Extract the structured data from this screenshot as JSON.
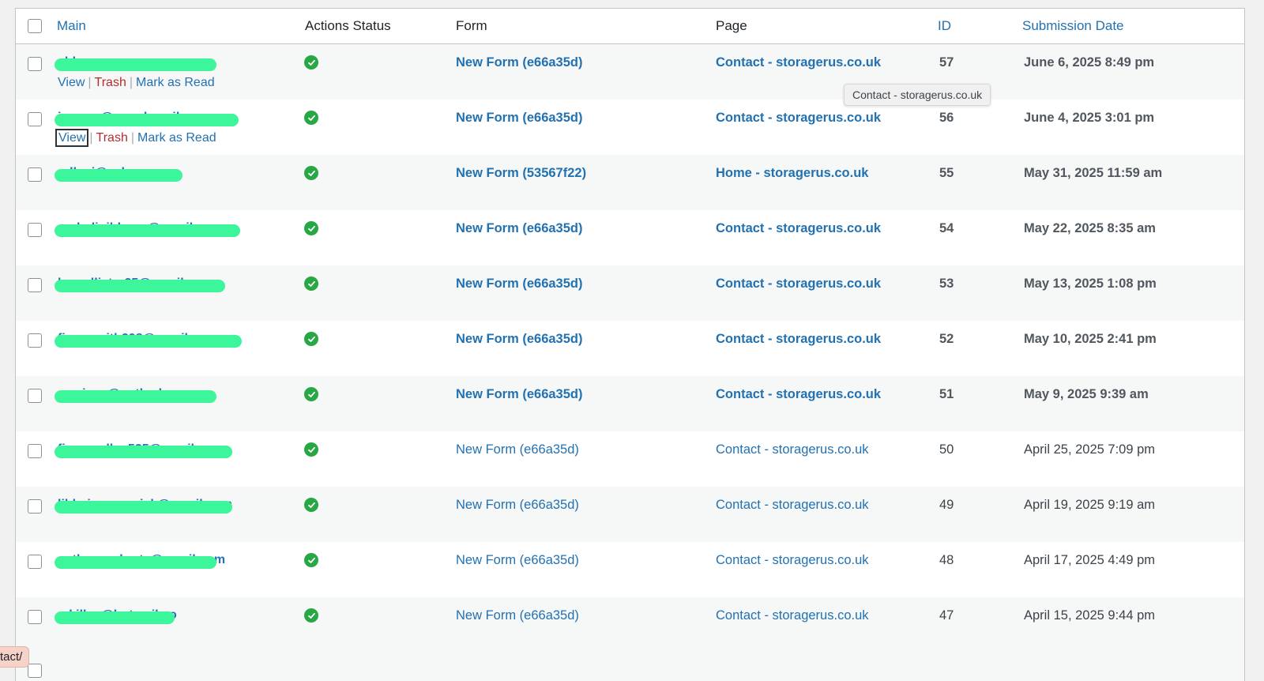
{
  "columns": {
    "main": "Main",
    "actions_status": "Actions Status",
    "form": "Form",
    "page": "Page",
    "id": "ID",
    "submission_date": "Submission Date"
  },
  "row_actions": {
    "view": "View",
    "trash": "Trash",
    "mark_read": "Mark as Read"
  },
  "tooltip": "Contact - storagerus.co.uk",
  "status_url": "tact/",
  "colors": {
    "link": "#2271b1",
    "trash": "#b32d2e",
    "success": "#28a745",
    "redaction": "#3df59a"
  },
  "rows": [
    {
      "email": "chloe",
      "form": "New Form (e66a35d)",
      "page": "Contact - storagerus.co.uk",
      "id": "57",
      "date": "June 6, 2025 8:49 pm",
      "unread": true
    },
    {
      "email": "jasonw@googlemail.com",
      "form": "New Form (e66a35d)",
      "page": "Contact - storagerus.co.uk",
      "id": "56",
      "date": "June 4, 2025 3:01 pm",
      "unread": true
    },
    {
      "email": "rellspj@yahoo.com",
      "form": "New Form (53567f22)",
      "page": "Home - storagerus.co.uk",
      "id": "55",
      "date": "May 31, 2025 11:59 am",
      "unread": true
    },
    {
      "email": "racheligibbons@gmail.com",
      "form": "New Form (e66a35d)",
      "page": "Contact - storagerus.co.uk",
      "id": "54",
      "date": "May 22, 2025 8:35 am",
      "unread": true
    },
    {
      "email": "bmcallister25@gmail.com",
      "form": "New Form (e66a35d)",
      "page": "Contact - storagerus.co.uk",
      "id": "53",
      "date": "May 13, 2025 1:08 pm",
      "unread": true
    },
    {
      "email": "fionasmith298@gmail.com",
      "form": "New Form (e66a35d)",
      "page": "Contact - storagerus.co.uk",
      "id": "52",
      "date": "May 10, 2025 2:41 pm",
      "unread": true
    },
    {
      "email": "corrie.m@outlook.com",
      "form": "New Form (e66a35d)",
      "page": "Contact - storagerus.co.uk",
      "id": "51",
      "date": "May 9, 2025 9:39 am",
      "unread": true
    },
    {
      "email": "fionamallen525@gmail.com",
      "form": "New Form (e66a35d)",
      "page": "Contact - storagerus.co.uk",
      "id": "50",
      "date": "April 25, 2025 7:09 pm",
      "unread": false
    },
    {
      "email": "libbyjmccormick@gmail.com",
      "form": "New Form (e66a35d)",
      "page": "Contact - storagerus.co.uk",
      "id": "49",
      "date": "April 19, 2025 9:19 am",
      "unread": false
    },
    {
      "email": "anthonyroberts@gmail.com",
      "form": "New Form (e66a35d)",
      "page": "Contact - storagerus.co.uk",
      "id": "48",
      "date": "April 17, 2025 4:49 pm",
      "unread": false
    },
    {
      "email": "mkillen@hotmail.co",
      "form": "New Form (e66a35d)",
      "page": "Contact - storagerus.co.uk",
      "id": "47",
      "date": "April 15, 2025 9:44 pm",
      "unread": false
    }
  ]
}
